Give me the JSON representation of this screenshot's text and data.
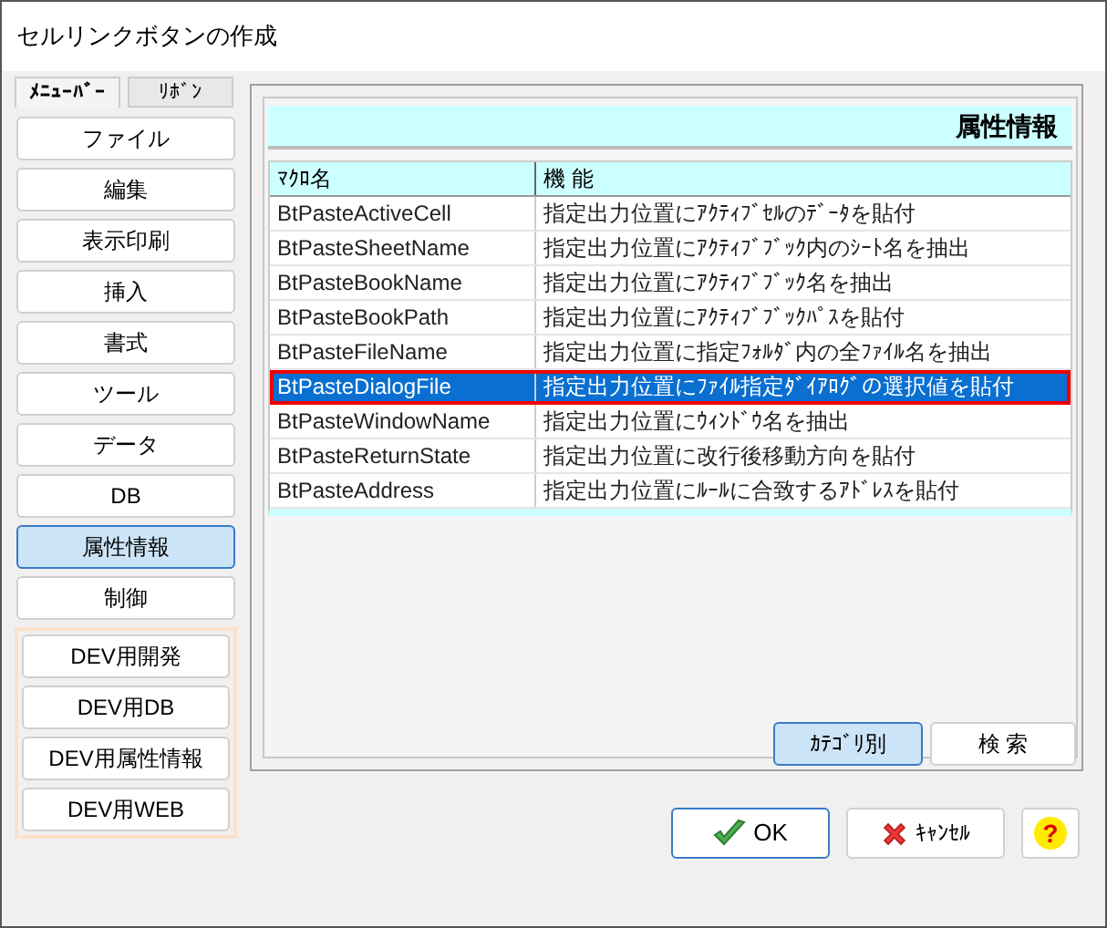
{
  "window": {
    "title": "セルリンクボタンの作成"
  },
  "menu_tabs": [
    {
      "label": "ﾒﾆｭｰﾊﾞｰ",
      "selected": true
    },
    {
      "label": "ﾘﾎﾞﾝ",
      "selected": false
    }
  ],
  "categories": [
    {
      "label": "ファイル",
      "selected": false
    },
    {
      "label": "編集",
      "selected": false
    },
    {
      "label": "表示印刷",
      "selected": false
    },
    {
      "label": "挿入",
      "selected": false
    },
    {
      "label": "書式",
      "selected": false
    },
    {
      "label": "ツール",
      "selected": false
    },
    {
      "label": "データ",
      "selected": false
    },
    {
      "label": "DB",
      "selected": false
    },
    {
      "label": "属性情報",
      "selected": true
    },
    {
      "label": "制御",
      "selected": false
    }
  ],
  "dev_categories": [
    {
      "label": "DEV用開発",
      "selected": false
    },
    {
      "label": "DEV用DB",
      "selected": false
    },
    {
      "label": "DEV用属性情報",
      "selected": false
    },
    {
      "label": "DEV用WEB",
      "selected": false
    }
  ],
  "panel_header": "属性情報",
  "table": {
    "columns": [
      "ﾏｸﾛ名",
      "機 能"
    ],
    "rows": [
      {
        "macro": "BtPasteActiveCell",
        "function": "指定出力位置にｱｸﾃｨﾌﾞｾﾙのﾃﾞｰﾀを貼付",
        "selected": false
      },
      {
        "macro": "BtPasteSheetName",
        "function": "指定出力位置にｱｸﾃｨﾌﾞﾌﾞｯｸ内のｼｰﾄ名を抽出",
        "selected": false
      },
      {
        "macro": "BtPasteBookName",
        "function": "指定出力位置にｱｸﾃｨﾌﾞﾌﾞｯｸ名を抽出",
        "selected": false
      },
      {
        "macro": "BtPasteBookPath",
        "function": "指定出力位置にｱｸﾃｨﾌﾞﾌﾞｯｸﾊﾟｽを貼付",
        "selected": false
      },
      {
        "macro": "BtPasteFileName",
        "function": "指定出力位置に指定ﾌｫﾙﾀﾞ内の全ﾌｧｲﾙ名を抽出",
        "selected": false
      },
      {
        "macro": "BtPasteDialogFile",
        "function": "指定出力位置にﾌｧｲﾙ指定ﾀﾞｲｱﾛｸﾞの選択値を貼付",
        "selected": true
      },
      {
        "macro": "BtPasteWindowName",
        "function": "指定出力位置にｳｨﾝﾄﾞｳ名を抽出",
        "selected": false
      },
      {
        "macro": "BtPasteReturnState",
        "function": "指定出力位置に改行後移動方向を貼付",
        "selected": false
      },
      {
        "macro": "BtPasteAddress",
        "function": "指定出力位置にﾙｰﾙに合致するｱﾄﾞﾚｽを貼付",
        "selected": false
      }
    ]
  },
  "view_tabs": [
    {
      "label": "ｶﾃｺﾞﾘ別",
      "selected": true
    },
    {
      "label": "検 索",
      "selected": false
    }
  ],
  "buttons": [
    {
      "kind": "ok",
      "label": "OK"
    },
    {
      "kind": "cancel",
      "label": "ｷｬﾝｾﾙ"
    },
    {
      "kind": "help",
      "label": "?"
    }
  ]
}
